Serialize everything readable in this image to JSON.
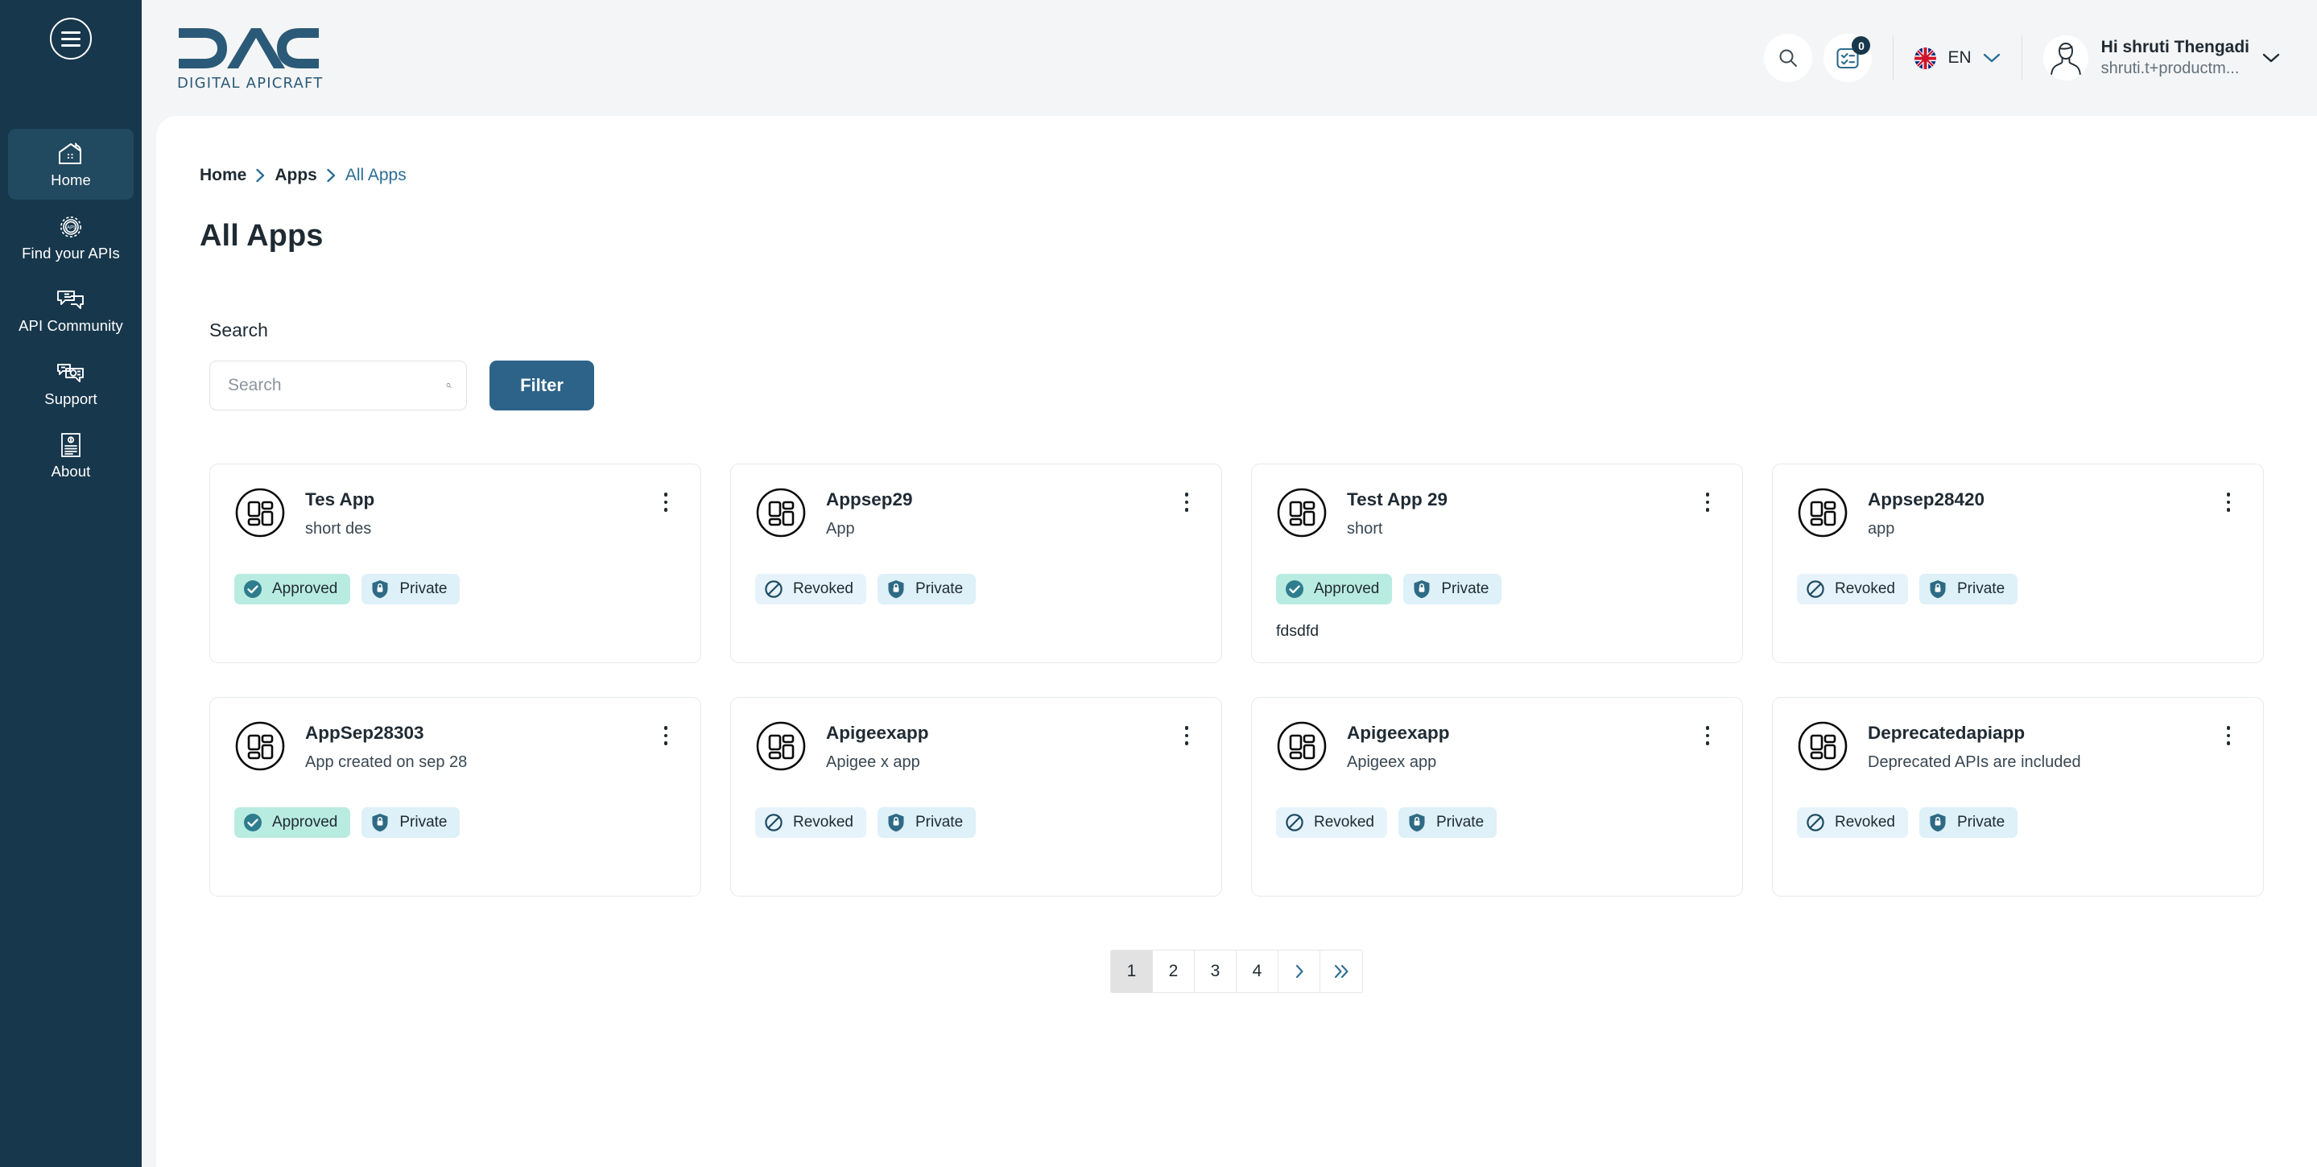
{
  "sidebar": {
    "menu_icon": "hamburger-icon",
    "items": [
      {
        "label": "Home",
        "icon": "home-icon",
        "active": true
      },
      {
        "label": "Find your APIs",
        "icon": "api-gear-icon",
        "active": false
      },
      {
        "label": "API Community",
        "icon": "chat-bubbles-icon",
        "active": false
      },
      {
        "label": "Support",
        "icon": "support-chat-icon",
        "active": false
      },
      {
        "label": "About",
        "icon": "document-info-icon",
        "active": false
      }
    ]
  },
  "header": {
    "logo_text": "DAC",
    "logo_subtitle": "DIGITAL APICRAFT",
    "search_icon": "search-icon",
    "tasks_icon": "checklist-icon",
    "tasks_badge_count": "0",
    "language_code": "EN",
    "language_flag": "uk-flag-icon",
    "language_chevron": "chevron-down-icon",
    "user_greeting": "Hi shruti Thengadi",
    "user_email": "shruti.t+productm...",
    "user_chevron": "chevron-down-icon",
    "avatar_icon": "avatar-icon"
  },
  "breadcrumb": [
    {
      "label": "Home",
      "current": false
    },
    {
      "label": "Apps",
      "current": false
    },
    {
      "label": "All Apps",
      "current": true
    }
  ],
  "page": {
    "title": "All Apps"
  },
  "search": {
    "label": "Search",
    "placeholder": "Search",
    "value": "",
    "icon": "search-icon",
    "filter_label": "Filter"
  },
  "colors": {
    "sidebar_bg": "#17374c",
    "sidebar_active": "#21495f",
    "page_bg": "#f4f5f6",
    "accent_blue": "#2d6388",
    "link_blue": "#2b6e96",
    "badge_approved_bg": "#b9ece0",
    "badge_revoked_bg": "#e6f3fa",
    "badge_private_bg": "#def0f8",
    "badge_icon_teal": "#2e7d8f",
    "badge_icon_navy": "#1e4b63"
  },
  "apps": [
    {
      "name": "Tes App",
      "description": "short des",
      "icon": "app-grid-icon",
      "menu_icon": "kebab-menu-icon",
      "badges": [
        {
          "label": "Approved",
          "type": "approved",
          "icon": "check-circle-icon"
        },
        {
          "label": "Private",
          "type": "private",
          "icon": "shield-lock-icon"
        }
      ],
      "note": ""
    },
    {
      "name": "Appsep29",
      "description": "App",
      "icon": "app-grid-icon",
      "menu_icon": "kebab-menu-icon",
      "badges": [
        {
          "label": "Revoked",
          "type": "revoked",
          "icon": "ban-circle-icon"
        },
        {
          "label": "Private",
          "type": "private",
          "icon": "shield-lock-icon"
        }
      ],
      "note": ""
    },
    {
      "name": "Test App 29",
      "description": "short",
      "icon": "app-grid-icon",
      "menu_icon": "kebab-menu-icon",
      "badges": [
        {
          "label": "Approved",
          "type": "approved",
          "icon": "check-circle-icon"
        },
        {
          "label": "Private",
          "type": "private",
          "icon": "shield-lock-icon"
        }
      ],
      "note": "fdsdfd"
    },
    {
      "name": "Appsep28420",
      "description": "app",
      "icon": "app-grid-icon",
      "menu_icon": "kebab-menu-icon",
      "badges": [
        {
          "label": "Revoked",
          "type": "revoked",
          "icon": "ban-circle-icon"
        },
        {
          "label": "Private",
          "type": "private",
          "icon": "shield-lock-icon"
        }
      ],
      "note": ""
    },
    {
      "name": "AppSep28303",
      "description": "App created on sep 28",
      "icon": "app-grid-icon",
      "menu_icon": "kebab-menu-icon",
      "badges": [
        {
          "label": "Approved",
          "type": "approved",
          "icon": "check-circle-icon"
        },
        {
          "label": "Private",
          "type": "private",
          "icon": "shield-lock-icon"
        }
      ],
      "note": ""
    },
    {
      "name": "Apigeexapp",
      "description": "Apigee x app",
      "icon": "app-grid-icon",
      "menu_icon": "kebab-menu-icon",
      "badges": [
        {
          "label": "Revoked",
          "type": "revoked",
          "icon": "ban-circle-icon"
        },
        {
          "label": "Private",
          "type": "private",
          "icon": "shield-lock-icon"
        }
      ],
      "note": ""
    },
    {
      "name": "Apigeexapp",
      "description": "Apigeex app",
      "icon": "app-grid-icon",
      "menu_icon": "kebab-menu-icon",
      "badges": [
        {
          "label": "Revoked",
          "type": "revoked",
          "icon": "ban-circle-icon"
        },
        {
          "label": "Private",
          "type": "private",
          "icon": "shield-lock-icon"
        }
      ],
      "note": ""
    },
    {
      "name": "Deprecatedapiapp",
      "description": "Deprecated APIs are included",
      "icon": "app-grid-icon",
      "menu_icon": "kebab-menu-icon",
      "badges": [
        {
          "label": "Revoked",
          "type": "revoked",
          "icon": "ban-circle-icon"
        },
        {
          "label": "Private",
          "type": "private",
          "icon": "shield-lock-icon"
        }
      ],
      "note": ""
    }
  ],
  "pagination": {
    "pages": [
      "1",
      "2",
      "3",
      "4"
    ],
    "active_page": "1",
    "next_label": "›",
    "last_label": "»"
  }
}
